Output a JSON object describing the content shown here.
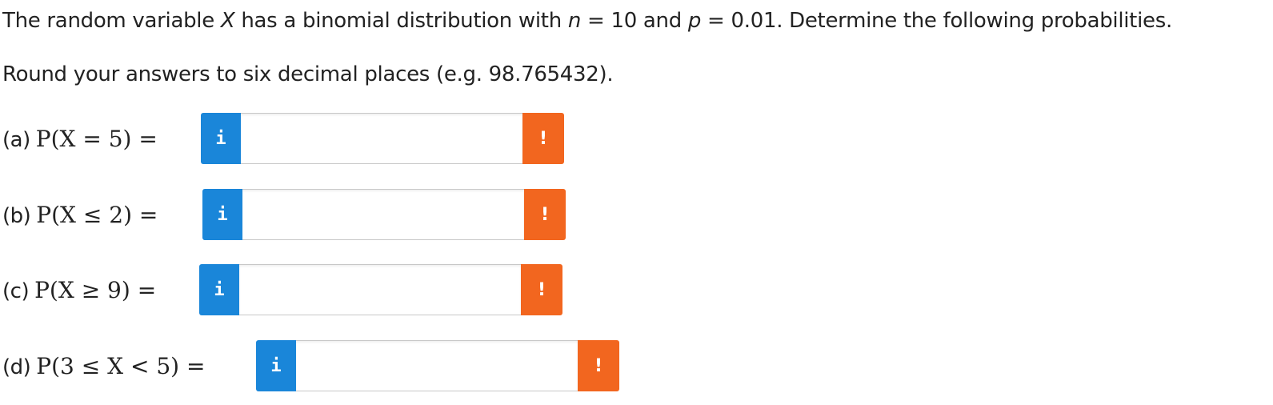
{
  "intro": {
    "text_1": "The random variable ",
    "var_X": "X",
    "text_2": " has a binomial distribution with ",
    "var_n": "n",
    "text_3": " = 10 and ",
    "var_p": "p",
    "text_4": " = 0.01. Determine the following probabilities."
  },
  "instruction": "Round your answers to six decimal places (e.g. 98.765432).",
  "questions": [
    {
      "part": "(a)",
      "expr": "P(X = 5) =",
      "value": "",
      "info_icon": "i",
      "warning_icon": "!"
    },
    {
      "part": "(b)",
      "expr": "P(X ≤ 2) =",
      "value": "",
      "info_icon": "i",
      "warning_icon": "!"
    },
    {
      "part": "(c)",
      "expr": "P(X ≥ 9) =",
      "value": "",
      "info_icon": "i",
      "warning_icon": "!"
    },
    {
      "part": "(d)",
      "expr": "P(3 ≤ X < 5) =",
      "value": "",
      "info_icon": "i",
      "warning_icon": "!"
    }
  ],
  "colors": {
    "info_button": "#1a86d9",
    "warning_button": "#f2661f",
    "text": "#222222"
  }
}
